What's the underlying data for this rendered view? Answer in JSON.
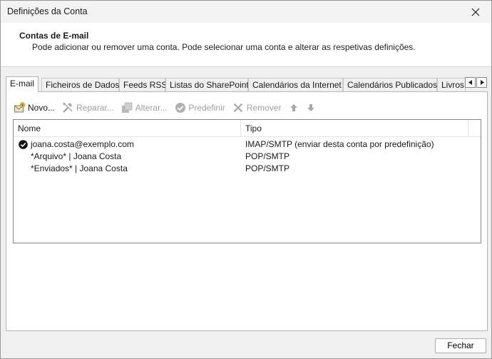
{
  "window": {
    "title": "Definições da Conta"
  },
  "header": {
    "title": "Contas de E-mail",
    "description": "Pode adicionar ou remover uma conta. Pode selecionar uma conta e alterar as respetivas definições."
  },
  "tabs": [
    {
      "label": "E-mail",
      "active": true
    },
    {
      "label": "Ficheiros de Dados"
    },
    {
      "label": "Feeds RSS"
    },
    {
      "label": "Listas do SharePoint"
    },
    {
      "label": "Calendários da Internet"
    },
    {
      "label": "Calendários Publicados"
    },
    {
      "label": "Livros"
    }
  ],
  "toolbar": {
    "new_label": "Novo...",
    "repair_label": "Reparar...",
    "change_label": "Alterar...",
    "default_label": "Predefinir",
    "remove_label": "Remover"
  },
  "accounts_list": {
    "columns": {
      "name": "Nome",
      "type": "Tipo"
    },
    "rows": [
      {
        "name": "joana.costa@exemplo.com",
        "type": "IMAP/SMTP (enviar desta conta por predefinição)",
        "is_default": true
      },
      {
        "name": "*Arquivo* | Joana Costa",
        "type": "POP/SMTP"
      },
      {
        "name": "*Enviados* | Joana Costa",
        "type": "POP/SMTP"
      }
    ]
  },
  "footer": {
    "close_label": "Fechar"
  }
}
